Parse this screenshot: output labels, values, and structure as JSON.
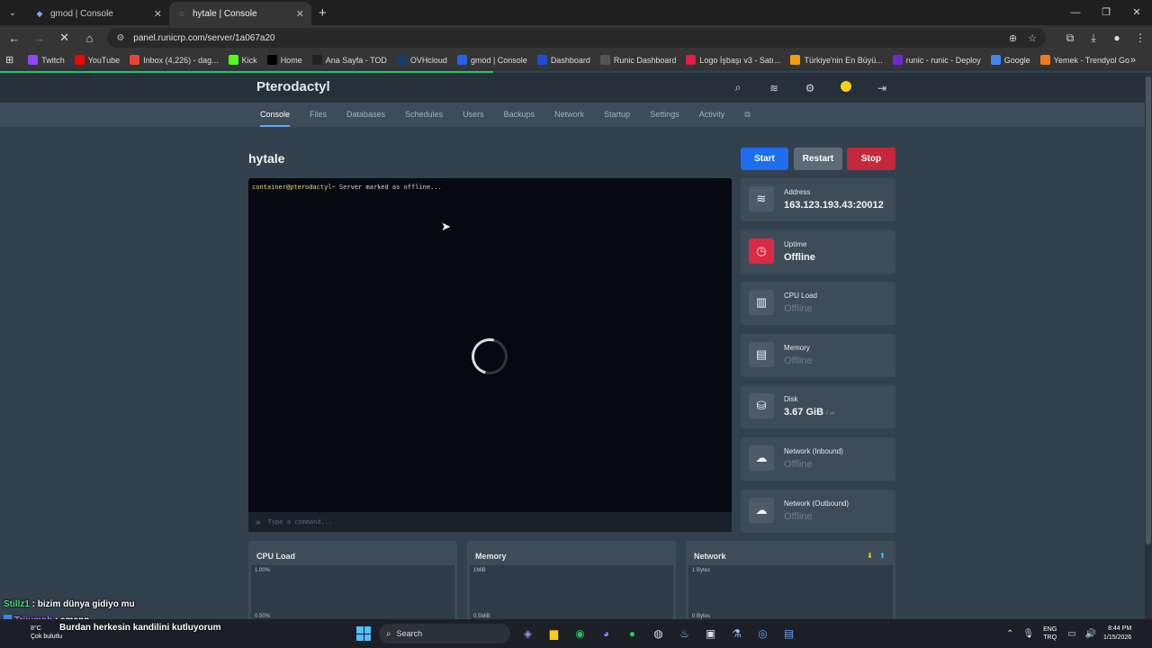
{
  "browser": {
    "tabs": [
      {
        "label": "gmod | Console",
        "active": false
      },
      {
        "label": "hytale | Console",
        "active": true
      }
    ],
    "url": "panel.runicrp.com/server/1a067a20",
    "bookmarks": [
      {
        "label": "Twitch",
        "icon": "twitch-icon",
        "color": "#9146ff"
      },
      {
        "label": "YouTube",
        "icon": "youtube-icon",
        "color": "#ff0000"
      },
      {
        "label": "Inbox (4,226) - dag...",
        "icon": "gmail-icon",
        "color": "#ea4335"
      },
      {
        "label": "Kick",
        "icon": "kick-icon",
        "color": "#53fc18"
      },
      {
        "label": "Home",
        "icon": "x-icon",
        "color": "#000000"
      },
      {
        "label": "Ana Sayfa - TOD",
        "icon": "tod-icon",
        "color": "#222222"
      },
      {
        "label": "OVHcloud",
        "icon": "ovh-icon",
        "color": "#123f6d"
      },
      {
        "label": "gmod | Console",
        "icon": "ptero-icon",
        "color": "#2563eb"
      },
      {
        "label": "Dashboard",
        "icon": "dashboard-icon",
        "color": "#1d4ed8"
      },
      {
        "label": "Runic Dashboard",
        "icon": "runic-icon",
        "color": "#555555"
      },
      {
        "label": "Logo İşbaşı v3 - Satı...",
        "icon": "logo-icon",
        "color": "#e11d48"
      },
      {
        "label": "Türkiye'nin En Büyü...",
        "icon": "sahibinden-icon",
        "color": "#f59e0b"
      },
      {
        "label": "runic - runic - Deploy",
        "icon": "railway-icon",
        "color": "#6d28d9"
      },
      {
        "label": "Google",
        "icon": "google-icon",
        "color": "#4285f4"
      },
      {
        "label": "Yemek - Trendyol Go",
        "icon": "trendyol-icon",
        "color": "#f27a1a"
      }
    ]
  },
  "app": {
    "brand": "Pterodactyl",
    "nav": [
      "Console",
      "Files",
      "Databases",
      "Schedules",
      "Users",
      "Backups",
      "Network",
      "Startup",
      "Settings",
      "Activity"
    ],
    "server_name": "hytale",
    "buttons": {
      "start": "Start",
      "restart": "Restart",
      "stop": "Stop"
    },
    "console": {
      "prompt": "container@pterodactyl~",
      "message": " Server marked as offline...",
      "placeholder": "Type a command..."
    },
    "stats": [
      {
        "label": "Address",
        "value": "163.123.193.43:20012",
        "icon": "wifi-icon",
        "dim": false
      },
      {
        "label": "Uptime",
        "value": "Offline",
        "icon": "clock-icon",
        "dim": false
      },
      {
        "label": "CPU Load",
        "value": "Offline",
        "icon": "cpu-icon",
        "dim": true
      },
      {
        "label": "Memory",
        "value": "Offline",
        "icon": "memory-icon",
        "dim": true
      },
      {
        "label": "Disk",
        "value": "3.67 GiB",
        "max": "/ ∞",
        "icon": "disk-icon",
        "dim": false
      },
      {
        "label": "Network (Inbound)",
        "value": "Offline",
        "icon": "cloud-download-icon",
        "dim": true
      },
      {
        "label": "Network (Outbound)",
        "value": "Offline",
        "icon": "cloud-upload-icon",
        "dim": true
      }
    ],
    "graphs": [
      {
        "title": "CPU Load",
        "ticks": [
          "1.00%",
          "0.50%"
        ]
      },
      {
        "title": "Memory",
        "ticks": [
          "1MiB",
          "0.5MiB"
        ]
      },
      {
        "title": "Network",
        "ticks": [
          "1 Bytes",
          "0 Bytes"
        ]
      }
    ]
  },
  "chat": [
    {
      "user": "Stillz1",
      "text": " : bizim dünya gidiyo mu"
    },
    {
      "user": "Triiumph",
      "text": " : amann"
    },
    {
      "user": "",
      "text": "Burdan herkesin kandilini kutluyorum"
    }
  ],
  "taskbar": {
    "weather_temp": "8°C",
    "weather_desc": "Çok bulutlu",
    "search": "Search",
    "lang_top": "ENG",
    "lang_bottom": "TRQ",
    "time": "8:44 PM",
    "date": "1/15/2026"
  }
}
